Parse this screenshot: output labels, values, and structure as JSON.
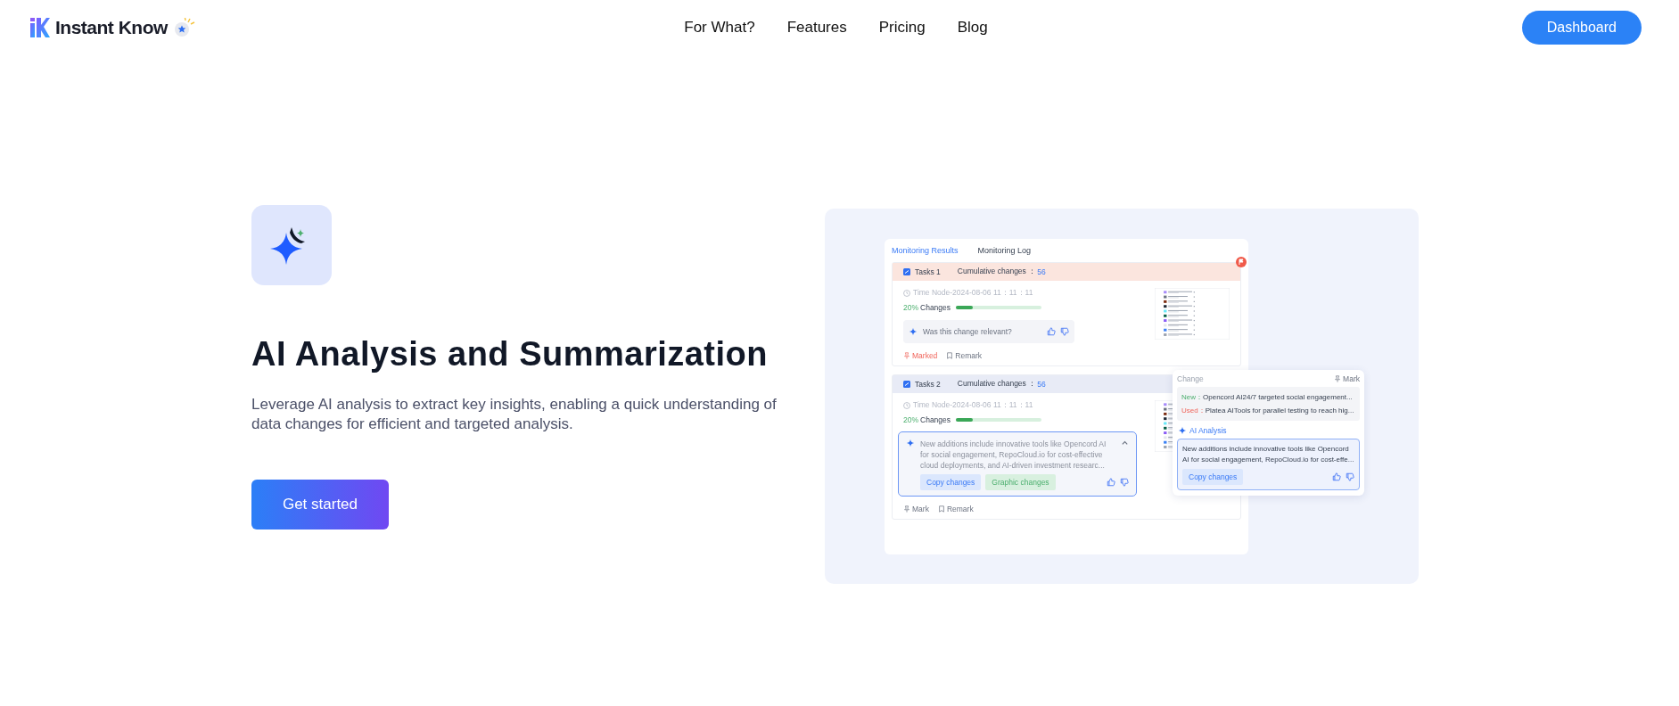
{
  "header": {
    "brand": "Instant Know",
    "nav": [
      {
        "label": "For What?"
      },
      {
        "label": "Features"
      },
      {
        "label": "Pricing"
      },
      {
        "label": "Blog"
      }
    ],
    "dashboard_button": "Dashboard"
  },
  "hero": {
    "title": "AI Analysis and Summarization",
    "description": "Leverage AI analysis to extract key insights, enabling a quick understanding of data changes for efficient and targeted analysis.",
    "cta": "Get started"
  },
  "mockup": {
    "tabs": [
      {
        "label": "Monitoring Results",
        "selected": true
      },
      {
        "label": "Monitoring Log",
        "selected": false
      }
    ],
    "tasks": [
      {
        "kind": "question",
        "name": "Tasks 1",
        "cumulative_label": "Cumulative changes ：",
        "cumulative_value": "56",
        "color": "#fbe5de",
        "flagged": true,
        "time_node": "Time Node-2024-08-06 11：11：11",
        "percent": "20%",
        "changes_label": "Changes",
        "level": 0.2,
        "question": "Was this change relevant?",
        "marked": true,
        "mark_label": "Marked",
        "remark_label": "Remark"
      },
      {
        "kind": "summary",
        "name": "Tasks 2",
        "cumulative_label": "Cumulative changes ：",
        "cumulative_value": "56",
        "color": "#e8ebf6",
        "flagged": false,
        "time_node": "Time Node-2024-08-06 11：11：11",
        "percent": "20%",
        "changes_label": "Changes",
        "level": 0.2,
        "summary": "New additions include innovative tools like Opencord AI for social engagement, RepoCloud.io for cost-effective cloud deployments, and AI-driven investment researc...",
        "buttons": [
          "Copy changes",
          "Graphic changes"
        ],
        "marked": false,
        "mark_label": "Mark",
        "remark_label": "Remark"
      }
    ],
    "popup": {
      "title": "Change",
      "mark": "Mark",
      "new_label": "New：",
      "new_text": "Opencord AI24/7 targeted social engagement...",
      "used_label": "Used：",
      "used_text": "Platea AITools for parallel testing to reach hig...",
      "analysis_title": "AI Analysis",
      "analysis_text": "New additions include innovative tools like Opencord AI for social engagement, RepoCloud.io for cost-effe...",
      "copy_button": "Copy changes"
    }
  }
}
